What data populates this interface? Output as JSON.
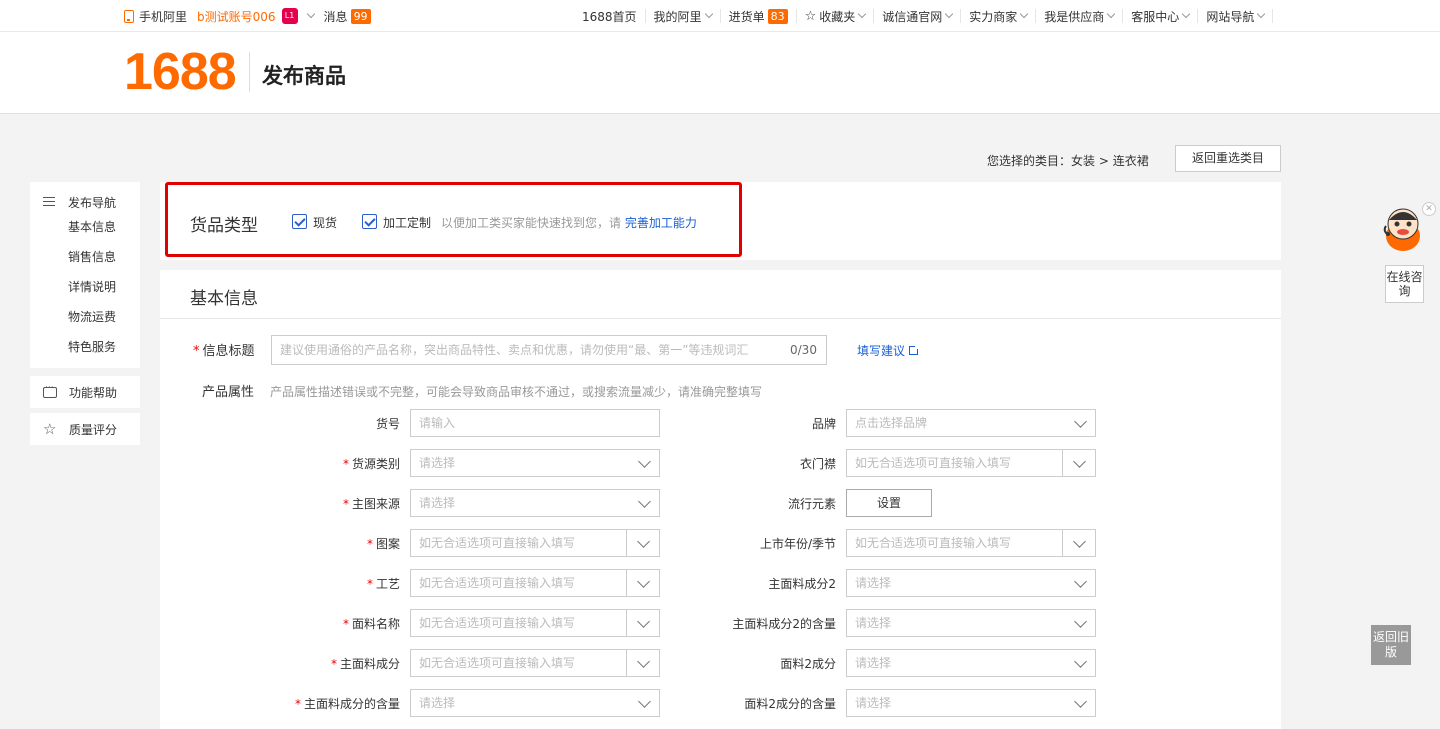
{
  "topbar": {
    "mobile": "手机阿里",
    "account": "b测试账号006",
    "level": "L1",
    "messages": "消息",
    "messages_count": "99",
    "nav": [
      {
        "label": "1688首页",
        "chev": false
      },
      {
        "label": "我的阿里",
        "chev": true
      },
      {
        "label": "进货单",
        "chev": false,
        "badge": "83"
      },
      {
        "label": "收藏夹",
        "chev": true,
        "icon": "star-icon"
      },
      {
        "label": "诚信通官网",
        "chev": true
      },
      {
        "label": "实力商家",
        "chev": true
      },
      {
        "label": "我是供应商",
        "chev": true
      },
      {
        "label": "客服中心",
        "chev": true
      },
      {
        "label": "网站导航",
        "chev": true
      }
    ]
  },
  "header": {
    "logo": "1688",
    "title": "发布商品"
  },
  "category": {
    "prefix": "您选择的类目：",
    "path": "女装 > 连衣裙",
    "back_button": "返回重选类目"
  },
  "sidebar": {
    "nav_title": "发布导航",
    "items": [
      "基本信息",
      "销售信息",
      "详情说明",
      "物流运费",
      "特色服务"
    ],
    "help": "功能帮助",
    "quality": "质量评分"
  },
  "goods_type": {
    "title": "货品类型",
    "option1": "现货",
    "option2": "加工定制",
    "hint": "以便加工类买家能快速找到您，请",
    "link": "完善加工能力"
  },
  "basic": {
    "title": "基本信息",
    "title_label": "信息标题",
    "title_placeholder": "建议使用通俗的产品名称，突出商品特性、卖点和优惠，请勿使用“最、第一”等违规词汇",
    "title_count": "0/30",
    "suggest_link": "填写建议",
    "attr_label": "产品属性",
    "attr_hint": "产品属性描述错误或不完整，可能会导致商品审核不通过，或搜索流量减少，请准确完整填写"
  },
  "fields_left": [
    {
      "label": "货号",
      "required": false,
      "placeholder": "请输入",
      "kind": "text"
    },
    {
      "label": "货源类别",
      "required": true,
      "placeholder": "请选择",
      "kind": "select"
    },
    {
      "label": "主图来源",
      "required": true,
      "placeholder": "请选择",
      "kind": "select"
    },
    {
      "label": "图案",
      "required": true,
      "placeholder": "如无合适选项可直接输入填写",
      "kind": "combo"
    },
    {
      "label": "工艺",
      "required": true,
      "placeholder": "如无合适选项可直接输入填写",
      "kind": "combo"
    },
    {
      "label": "面料名称",
      "required": true,
      "placeholder": "如无合适选项可直接输入填写",
      "kind": "combo"
    },
    {
      "label": "主面料成分",
      "required": true,
      "placeholder": "如无合适选项可直接输入填写",
      "kind": "combo"
    },
    {
      "label": "主面料成分的含量",
      "required": true,
      "placeholder": "请选择",
      "kind": "select"
    }
  ],
  "fields_right": [
    {
      "label": "品牌",
      "placeholder": "点击选择品牌",
      "kind": "select"
    },
    {
      "label": "衣门襟",
      "placeholder": "如无合适选项可直接输入填写",
      "kind": "combo"
    },
    {
      "label": "流行元素",
      "placeholder": "",
      "kind": "button",
      "button_label": "设置"
    },
    {
      "label": "上市年份/季节",
      "placeholder": "如无合适选项可直接输入填写",
      "kind": "combo"
    },
    {
      "label": "主面料成分2",
      "placeholder": "请选择",
      "kind": "select"
    },
    {
      "label": "主面料成分2的含量",
      "placeholder": "请选择",
      "kind": "select"
    },
    {
      "label": "面料2成分",
      "placeholder": "请选择",
      "kind": "select"
    },
    {
      "label": "面料2成分的含量",
      "placeholder": "请选择",
      "kind": "select"
    }
  ],
  "widgets": {
    "consult": "在线咨询",
    "old_version": "返回旧版"
  },
  "colors": {
    "brand": "#ff6a00",
    "link": "#1a5ed6",
    "highlight": "#e00000"
  }
}
